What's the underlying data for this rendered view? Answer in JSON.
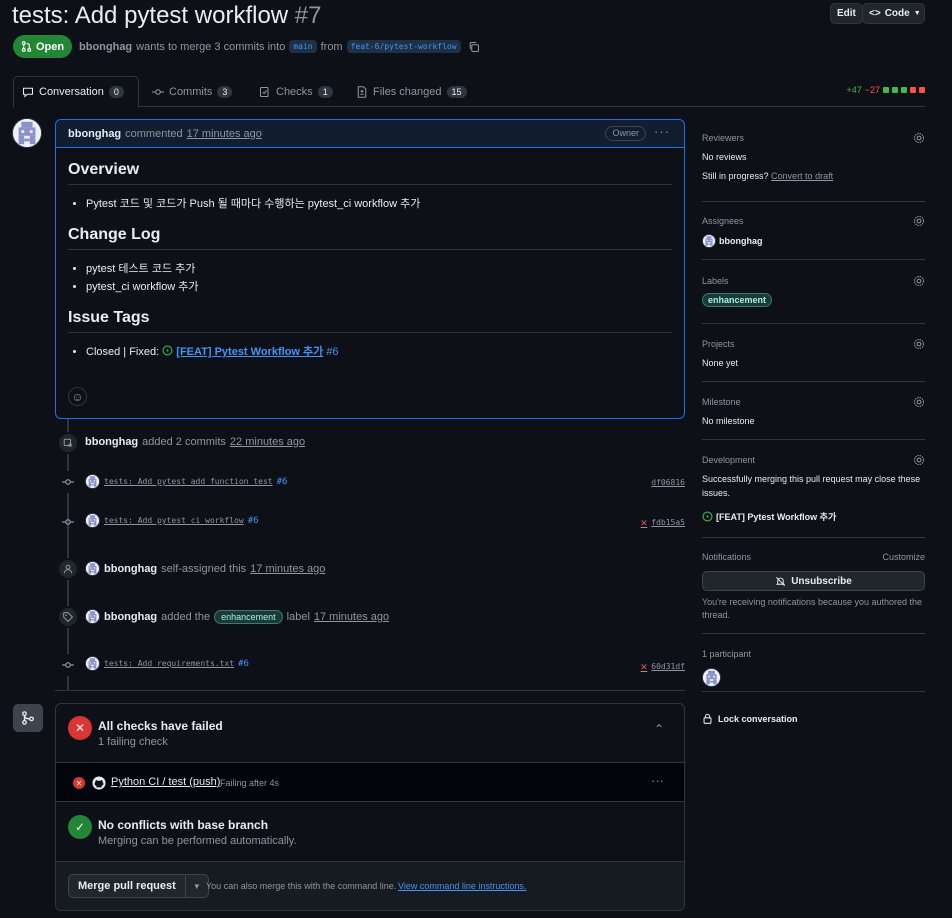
{
  "header": {
    "title": "tests: Add pytest workflow",
    "number": "#7",
    "edit_label": "Edit",
    "code_label": "Code",
    "state": "Open",
    "author": "bbonghag",
    "meta_text": "wants to merge 3 commits into",
    "base_branch": "main",
    "from_text": "from",
    "head_branch": "feat-6/pytest-workflow"
  },
  "tabs": [
    {
      "label": "Conversation",
      "count": "0"
    },
    {
      "label": "Commits",
      "count": "3"
    },
    {
      "label": "Checks",
      "count": "1"
    },
    {
      "label": "Files changed",
      "count": "15"
    }
  ],
  "diffstat": {
    "additions": "+47",
    "deletions": "−27"
  },
  "comment": {
    "author": "bbonghag",
    "action": "commented",
    "time": "17 minutes ago",
    "badge": "Owner",
    "h_overview": "Overview",
    "overview_item": "Pytest 코드 및 코드가 Push 될 때마다 수행하는 pytest_ci workflow 추가",
    "h_changelog": "Change Log",
    "changelog_items": [
      "pytest 테스트 코드 추가",
      "pytest_ci workflow 추가"
    ],
    "h_issue": "Issue Tags",
    "issue_prefix": "Closed | Fixed:",
    "issue_link": "[FEAT] Pytest Workflow 추가",
    "issue_num": "#6"
  },
  "timeline": {
    "commits_event": {
      "user": "bbonghag",
      "text": "added 2 commits",
      "time": "22 minutes ago"
    },
    "commits": [
      {
        "msg": "tests: Add pytest add function test",
        "ref": "#6",
        "sha": "df06816",
        "failed": false
      },
      {
        "msg": "tests: Add pytest ci workflow",
        "ref": "#6",
        "sha": "fdb15a5",
        "failed": true
      }
    ],
    "assign_event": {
      "user": "bbonghag",
      "text": "self-assigned this",
      "time": "17 minutes ago"
    },
    "label_event": {
      "user": "bbonghag",
      "pre": "added the",
      "label": "enhancement",
      "post": "label",
      "time": "17 minutes ago"
    },
    "commit3": {
      "msg": "tests: Add requirements.txt",
      "ref": "#6",
      "sha": "60d31df",
      "failed": true
    }
  },
  "merge": {
    "checks_title": "All checks have failed",
    "checks_sub": "1 failing check",
    "check_name": "Python CI / test (push)",
    "check_status": "Failing after 4s",
    "conflict_title": "No conflicts with base branch",
    "conflict_sub": "Merging can be performed automatically.",
    "merge_btn": "Merge pull request",
    "cli_text": "You can also merge this with the command line.",
    "cli_link": "View command line instructions."
  },
  "sidebar": {
    "reviewers_h": "Reviewers",
    "reviewers_v": "No reviews",
    "still_progress": "Still in progress?",
    "convert_draft": "Convert to draft",
    "assignees_h": "Assignees",
    "assignee": "bbonghag",
    "labels_h": "Labels",
    "label": "enhancement",
    "projects_h": "Projects",
    "projects_v": "None yet",
    "milestone_h": "Milestone",
    "milestone_v": "No milestone",
    "development_h": "Development",
    "development_text1": "Successfully merging this pull request may close these",
    "development_text2": "issues.",
    "development_issue": "[FEAT] Pytest Workflow 추가",
    "notifications_h": "Notifications",
    "customize": "Customize",
    "unsubscribe": "Unsubscribe",
    "notif_text1": "You're receiving notifications because you authored the",
    "notif_text2": "thread.",
    "participants": "1 participant",
    "lock": "Lock conversation"
  },
  "colors": {
    "accent": "#1f6feb",
    "success": "#238636",
    "danger": "#da3633",
    "link": "#4493f8"
  }
}
